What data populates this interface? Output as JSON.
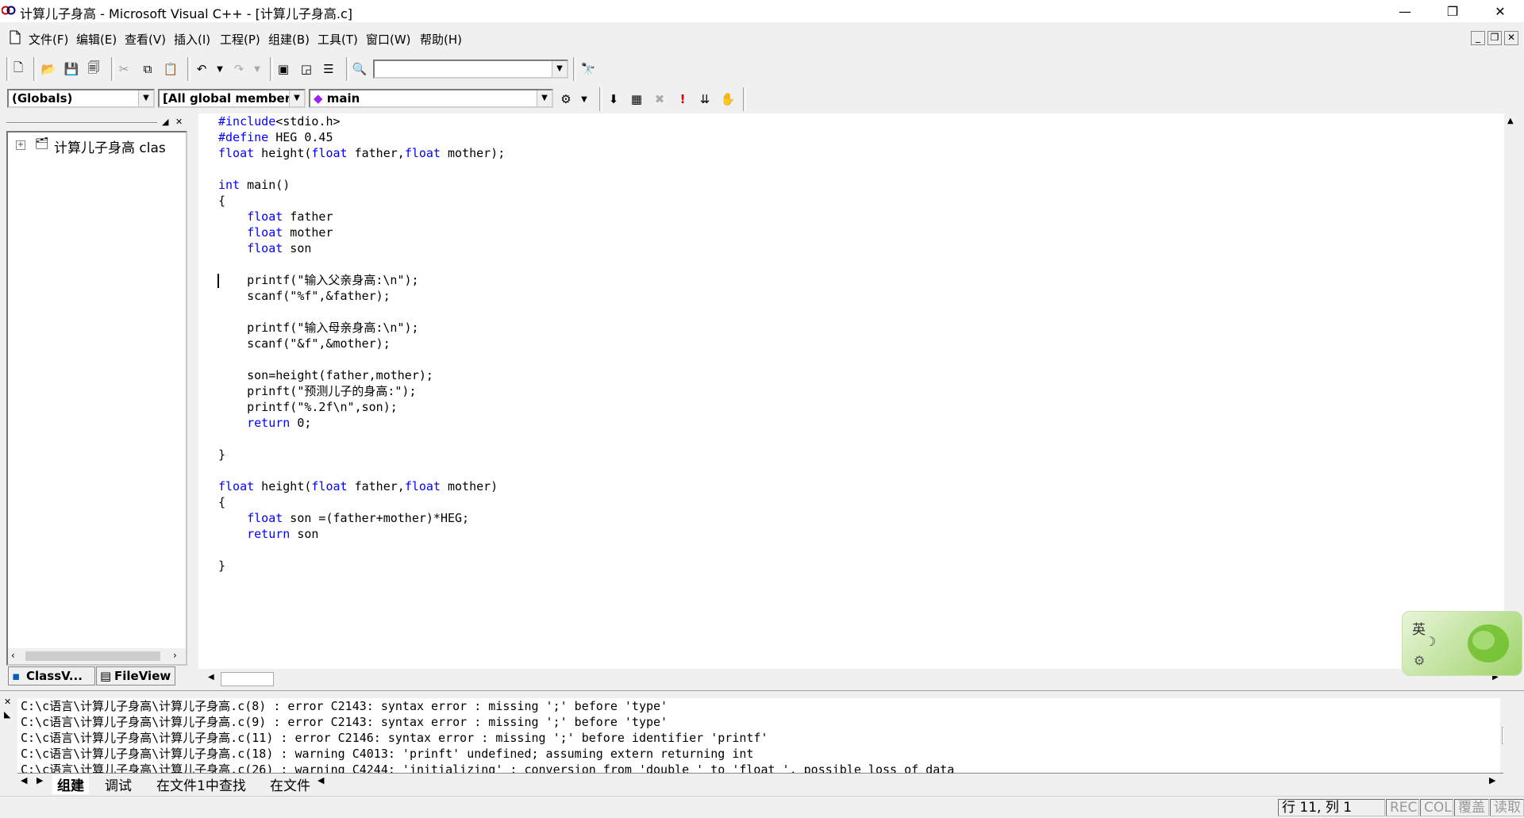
{
  "window": {
    "title": "计算儿子身高 - Microsoft Visual C++ - [计算儿子身高.c]",
    "minimize": "—",
    "restore": "❐",
    "close": "✕"
  },
  "menu": [
    "文件(F)",
    "编辑(E)",
    "查看(V)",
    "插入(I)",
    "工程(P)",
    "组建(B)",
    "工具(T)",
    "窗口(W)",
    "帮助(H)"
  ],
  "mdi_controls": [
    "_",
    "❐",
    "✕"
  ],
  "toolbar2": {
    "globals": "(Globals)",
    "members": "[All global members",
    "function": "main"
  },
  "classview": {
    "tree_item": "计算儿子身高 clas",
    "expand": "+",
    "tabs": [
      "ClassV...",
      "FileView"
    ]
  },
  "code": [
    "#include<stdio.h>",
    "#define HEG 0.45",
    "float height(float father,float mother);",
    "",
    "int main()",
    "{",
    "    float father",
    "    float mother",
    "    float son",
    "",
    "    printf(\"输入父亲身高:\\n\");",
    "    scanf(\"%f\",&father);",
    "",
    "    printf(\"输入母亲身高:\\n\");",
    "    scanf(\"&f\",&mother);",
    "",
    "    son=height(father,mother);",
    "    prinft(\"预测儿子的身高:\");",
    "    printf(\"%.2f\\n\",son);",
    "    return 0;",
    "",
    "}",
    "",
    "float height(float father,float mother)",
    "{",
    "    float son =(father+mother)*HEG;",
    "    return son",
    "",
    "}"
  ],
  "output": [
    "C:\\c语言\\计算儿子身高\\计算儿子身高.c(8) : error C2143: syntax error : missing ';' before 'type'",
    "C:\\c语言\\计算儿子身高\\计算儿子身高.c(9) : error C2143: syntax error : missing ';' before 'type'",
    "C:\\c语言\\计算儿子身高\\计算儿子身高.c(11) : error C2146: syntax error : missing ';' before identifier 'printf'",
    "C:\\c语言\\计算儿子身高\\计算儿子身高.c(18) : warning C4013: 'prinft' undefined; assuming extern returning int",
    "C:\\c语言\\计算儿子身高\\计算儿子身高.c(26) : warning C4244: 'initializing' : conversion from 'double ' to 'float ', possible loss of data"
  ],
  "output_tabs": [
    "组建",
    "调试",
    "在文件1中查找",
    "在文件"
  ],
  "status": {
    "position": "行 11, 列 1",
    "rec": "REC",
    "col": "COL",
    "ovr": "覆盖",
    "read": "读取"
  },
  "ime": {
    "lang": "英"
  }
}
